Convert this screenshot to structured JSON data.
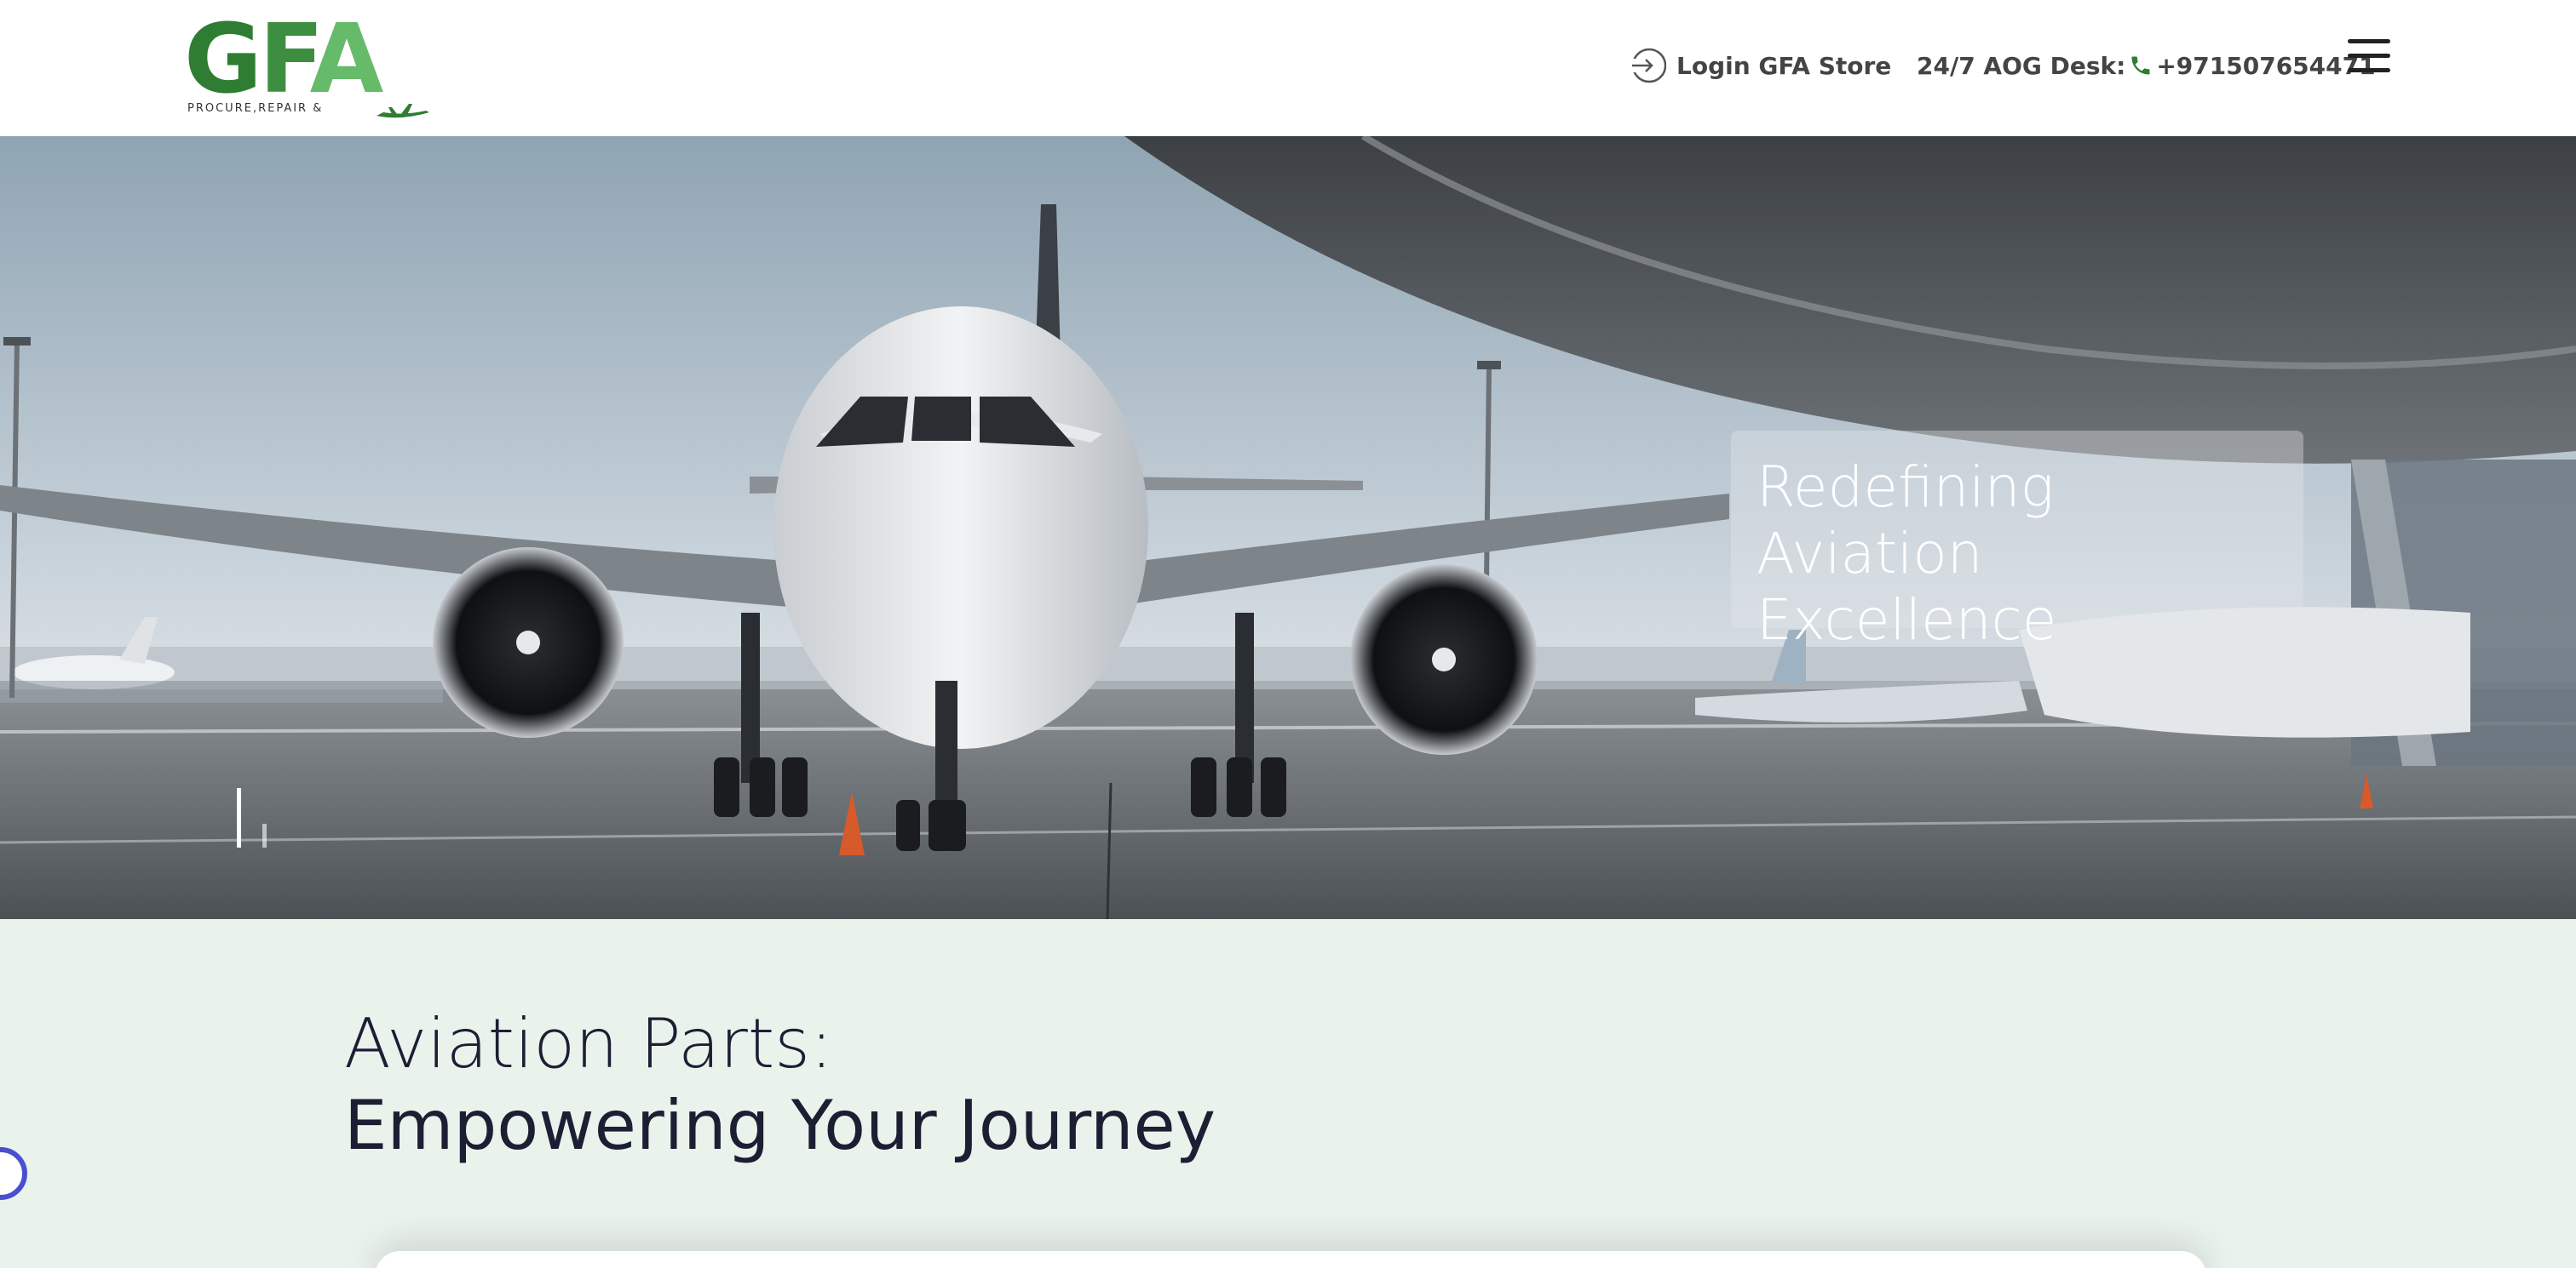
{
  "brand": {
    "logo_text": "GFA",
    "tagline": "PROCURE,REPAIR &",
    "colors": {
      "dark_green": "#2e7d32",
      "light_green": "#66bb6a"
    }
  },
  "header": {
    "login_label": "Login GFA Store",
    "aog_label": "24/7 AOG Desk:",
    "aog_phone": "+971507654471",
    "icons": {
      "login": "login-arrow-icon",
      "phone": "phone-icon",
      "menu": "hamburger-menu-icon"
    }
  },
  "hero": {
    "headline_line1": "Redefining",
    "headline_line2": "Aviation Excellence"
  },
  "section": {
    "title_line1": "Aviation Parts:",
    "title_line2": "Empowering Your Journey",
    "background": "#eaf2ec",
    "text_color": "#1c1f33"
  }
}
